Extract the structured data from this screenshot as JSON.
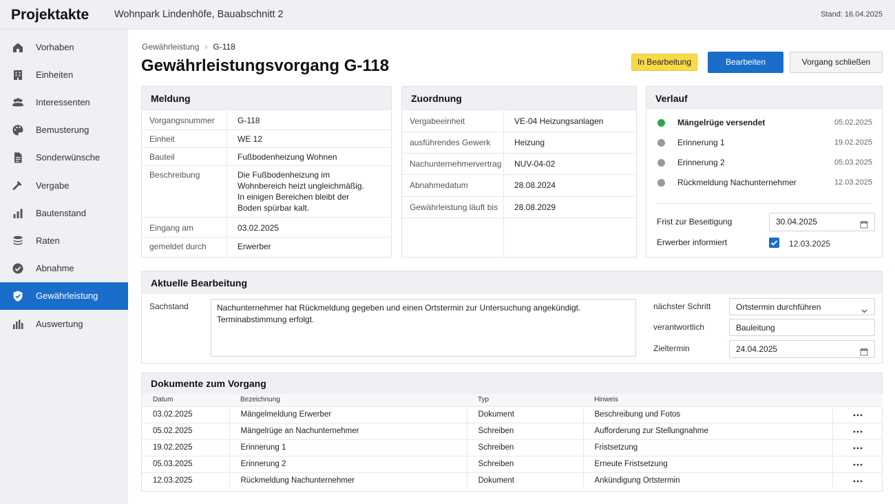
{
  "header": {
    "app_title": "Projektakte",
    "project": "Wohnpark Lindenhöfe, Bauabschnitt 2",
    "stand": "Stand: 16.04.2025"
  },
  "sidebar": {
    "items": [
      {
        "label": "Vorhaben",
        "icon": "home-icon"
      },
      {
        "label": "Einheiten",
        "icon": "building-icon"
      },
      {
        "label": "Interessenten",
        "icon": "people-icon"
      },
      {
        "label": "Bemusterung",
        "icon": "palette-icon"
      },
      {
        "label": "Sonderwünsche",
        "icon": "document-icon"
      },
      {
        "label": "Vergabe",
        "icon": "hammer-icon"
      },
      {
        "label": "Bautenstand",
        "icon": "bar-chart-icon"
      },
      {
        "label": "Raten",
        "icon": "coins-icon"
      },
      {
        "label": "Abnahme",
        "icon": "check-circle-icon"
      },
      {
        "label": "Gewährleistung",
        "icon": "shield-icon",
        "active": true
      },
      {
        "label": "Auswertung",
        "icon": "chart-icon"
      }
    ]
  },
  "breadcrumb": {
    "parent": "Gewährleistung",
    "current": "G-118"
  },
  "page_title": "Gewährleistungsvorgang G-118",
  "status_badge": "In Bearbeitung",
  "actions": {
    "edit": "Bearbeiten",
    "close": "Vorgang schließen"
  },
  "meldung": {
    "title": "Meldung",
    "rows": [
      {
        "key": "Vorgangsnummer",
        "value": "G-118"
      },
      {
        "key": "Einheit",
        "value": "WE 12"
      },
      {
        "key": "Bauteil",
        "value": "Fußbodenheizung Wohnen"
      },
      {
        "key": "Beschreibung",
        "value": "Die Fußbodenheizung im Wohnbereich heizt ungleichmäßig. In einigen Bereichen bleibt der Boden spürbar kalt."
      },
      {
        "key": "Eingang am",
        "value": "03.02.2025"
      },
      {
        "key": "gemeldet durch",
        "value": "Erwerber"
      }
    ]
  },
  "zuordnung": {
    "title": "Zuordnung",
    "rows": [
      {
        "key": "Vergabeeinheit",
        "value": "VE-04 Heizungsanlagen"
      },
      {
        "key": "ausführendes Gewerk",
        "value": "Heizung"
      },
      {
        "key": "Nachunternehmervertrag",
        "value": "NUV-04-02"
      },
      {
        "key": "Abnahmedatum",
        "value": "28.08.2024"
      },
      {
        "key": "Gewährleistung läuft bis",
        "value": "28.08.2029"
      }
    ]
  },
  "verlauf": {
    "title": "Verlauf",
    "items": [
      {
        "label": "Mängelrüge versendet",
        "date": "05.02.2025",
        "status": "done"
      },
      {
        "label": "Erinnerung 1",
        "date": "19.02.2025",
        "status": "neutral"
      },
      {
        "label": "Erinnerung 2",
        "date": "05.03.2025",
        "status": "neutral"
      },
      {
        "label": "Rückmeldung Nachunternehmer",
        "date": "12.03.2025",
        "status": "neutral"
      }
    ],
    "frist_label": "Frist zur Beseitigung",
    "frist_value": "30.04.2025",
    "informiert_label": "Erwerber informiert",
    "informiert_checked": true,
    "informiert_date": "12.03.2025"
  },
  "bearbeitung": {
    "title": "Aktuelle Bearbeitung",
    "sachstand_label": "Sachstand",
    "sachstand": "Nachunternehmer hat Rückmeldung gegeben und einen Ortstermin zur Untersuchung angekündigt. Terminabstimmung erfolgt.",
    "next_step_label": "nächster Schritt",
    "next_step": "Ortstermin durchführen",
    "responsible_label": "verantwortlich",
    "responsible": "Bauleitung",
    "target_label": "Zieltermin",
    "target": "24.04.2025"
  },
  "dokumente": {
    "title": "Dokumente zum Vorgang",
    "columns": [
      "Datum",
      "Bezeichnung",
      "Typ",
      "Hinweis"
    ],
    "rows": [
      [
        "03.02.2025",
        "Mängelmeldung Erwerber",
        "Dokument",
        "Beschreibung und Fotos"
      ],
      [
        "05.02.2025",
        "Mängelrüge an Nachunternehmer",
        "Schreiben",
        "Aufforderung zur Stellungnahme"
      ],
      [
        "19.02.2025",
        "Erinnerung 1",
        "Schreiben",
        "Fristsetzung"
      ],
      [
        "05.03.2025",
        "Erinnerung 2",
        "Schreiben",
        "Erneute Fristsetzung"
      ],
      [
        "12.03.2025",
        "Rückmeldung Nachunternehmer",
        "Dokument",
        "Ankündigung Ortstermin"
      ]
    ]
  },
  "colors": {
    "accent": "#1a6dc9",
    "badge": "#f8d94a",
    "done": "#2aa84a",
    "neutral": "#999999"
  }
}
